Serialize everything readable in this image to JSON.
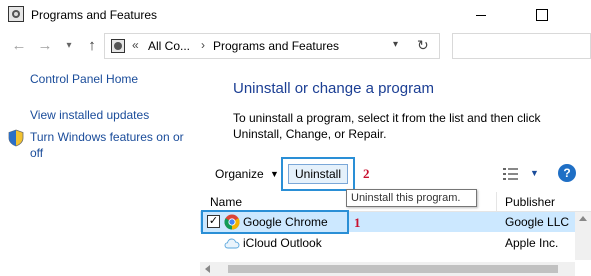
{
  "window": {
    "title": "Programs and Features"
  },
  "address": {
    "crumb1": "All Co...",
    "crumb2": "Programs and Features",
    "overflow_chevron": "«"
  },
  "left_panel": {
    "home": "Control Panel Home",
    "updates": "View installed updates",
    "features": "Turn Windows features on or off"
  },
  "main": {
    "title": "Uninstall or change a program",
    "description": "To uninstall a program, select it from the list and then click Uninstall, Change, or Repair."
  },
  "toolbar": {
    "organize": "Organize",
    "uninstall": "Uninstall",
    "help": "?"
  },
  "tooltip": "Uninstall this program.",
  "list": {
    "columns": {
      "name": "Name",
      "publisher": "Publisher"
    },
    "rows": [
      {
        "name": "Google Chrome",
        "publisher": "Google LLC",
        "checked": true
      },
      {
        "name": "iCloud Outlook",
        "publisher": "Apple Inc."
      }
    ]
  },
  "annotations": {
    "callout_1": "1",
    "callout_2": "2",
    "color": "#c8102e",
    "highlight_color": "#2a8fd6"
  },
  "icons": [
    "programs-features-icon",
    "back-arrow-icon",
    "forward-arrow-icon",
    "up-arrow-icon",
    "refresh-icon",
    "shield-icon",
    "view-options-icon",
    "help-icon",
    "chrome-icon",
    "icloud-icon"
  ]
}
